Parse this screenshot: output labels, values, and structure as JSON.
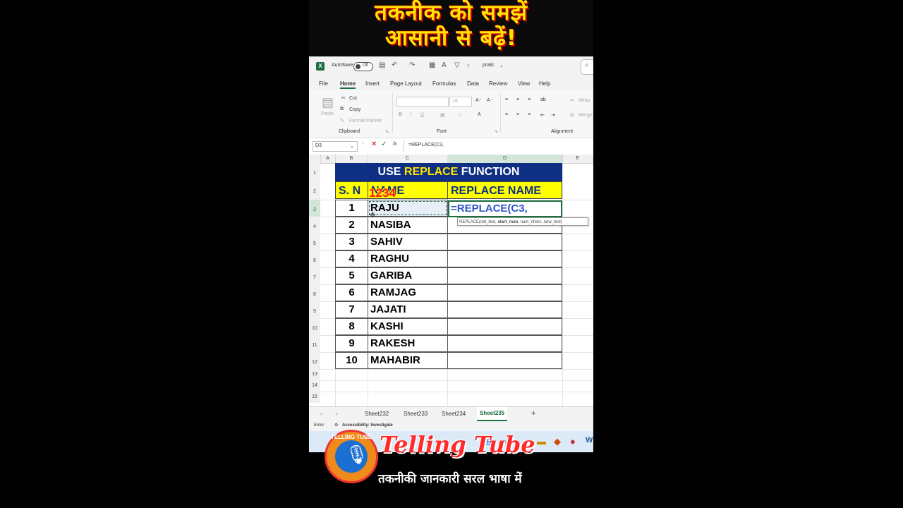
{
  "banner": {
    "line1": "तकनीक को समझें",
    "line2": "आसानी से बढ़ें!"
  },
  "titlebar": {
    "autosave": "AutoSave",
    "toggle": "Off",
    "user": "pratic"
  },
  "menu": [
    "File",
    "Home",
    "Insert",
    "Page Layout",
    "Formulas",
    "Data",
    "Review",
    "View",
    "Help"
  ],
  "ribbon": {
    "paste": "Paste",
    "cut": "Cut",
    "copy": "Copy",
    "format_painter": "Format Painter",
    "font_size": "18",
    "wrap": "Wrap",
    "merge": "Merge",
    "groups": {
      "clipboard": "Clipboard",
      "font": "Font",
      "alignment": "Alignment"
    }
  },
  "formula_bar": {
    "name_box": "D3",
    "fx": "fx",
    "formula": "=REPLACE(C3,"
  },
  "columns": [
    "A",
    "B",
    "C",
    "D",
    "E"
  ],
  "rows": [
    "1",
    "2",
    "3",
    "4",
    "5",
    "6",
    "7",
    "8",
    "9",
    "10",
    "11",
    "12",
    "13",
    "14",
    "15"
  ],
  "sheet": {
    "title_part1": "USE ",
    "title_hl": "REPLACE",
    "title_part2": " FUNCTION",
    "headers": {
      "sn": "S. N",
      "name": "NAME",
      "replace": "REPLACE NAME"
    },
    "data": [
      {
        "sn": "1",
        "name": "RAJU"
      },
      {
        "sn": "2",
        "name": "NASIBA"
      },
      {
        "sn": "3",
        "name": "SAHIV"
      },
      {
        "sn": "4",
        "name": "RAGHU"
      },
      {
        "sn": "5",
        "name": "GARIBA"
      },
      {
        "sn": "6",
        "name": "RAMJAG"
      },
      {
        "sn": "7",
        "name": "JAJATI"
      },
      {
        "sn": "8",
        "name": "KASHI"
      },
      {
        "sn": "9",
        "name": "RAKESH"
      },
      {
        "sn": "10",
        "name": "MAHABIR"
      }
    ],
    "editing_text": "=REPLACE(C3,",
    "tooltip_pre": "REPLACE(old_text, ",
    "tooltip_bold": "start_num",
    "tooltip_post": ", num_chars, new_text)",
    "overlay": "1234"
  },
  "sheet_tabs": [
    "Sheet232",
    "Sheet233",
    "Sheet234",
    "Sheet235"
  ],
  "active_tab": "Sheet235",
  "add_sheet": "+",
  "status": {
    "mode": "Enter",
    "accessibility": "Accessibility: Investigate"
  },
  "branding": {
    "logo_text": "TELLING TUBE",
    "name": "Telling Tube",
    "tagline": "तकनीकी जानकारी सरल भाषा में"
  },
  "colors": {
    "excel_green": "#1d6f42",
    "title_bg": "#0e2f83",
    "header_yellow": "#ffff00",
    "banner_yellow": "#ffe600"
  }
}
